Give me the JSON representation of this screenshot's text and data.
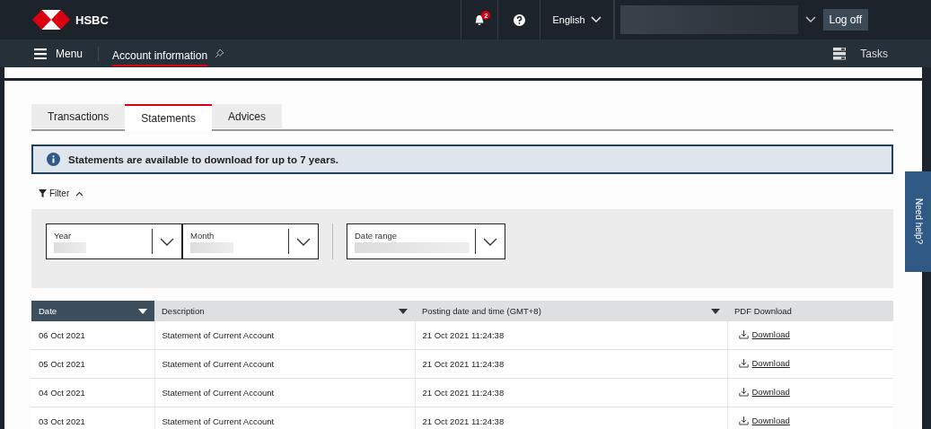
{
  "header": {
    "brand": "HSBC",
    "notifications": {
      "count": "2"
    },
    "language": "English",
    "logoff": "Log off"
  },
  "nav": {
    "menu": "Menu",
    "items": [
      {
        "label": "Account information",
        "selected": true
      }
    ],
    "tasks": "Tasks"
  },
  "tabs": [
    {
      "label": "Transactions",
      "selected": false
    },
    {
      "label": "Statements",
      "selected": true
    },
    {
      "label": "Advices",
      "selected": false
    }
  ],
  "notice": "Statements are available to download for up to 7 years.",
  "filter": {
    "label": "Filter",
    "expanded": true,
    "fields": [
      {
        "label": "Year"
      },
      {
        "label": "Month"
      },
      {
        "label": "Date range"
      }
    ]
  },
  "table": {
    "columns": [
      {
        "label": "Date",
        "sortable": true,
        "selected": true
      },
      {
        "label": "Description",
        "sortable": true,
        "selected": false
      },
      {
        "label": "Posting date and time (GMT+8)",
        "sortable": true,
        "selected": false
      },
      {
        "label": "PDF Download",
        "sortable": false,
        "selected": false
      }
    ],
    "rows": [
      [
        "06 Oct 2021",
        "Statement of Current Account",
        "21 Oct 2021 11:24:38",
        "Download"
      ],
      [
        "05 Oct 2021",
        "Statement of Current Account",
        "21 Oct 2021 11:24:38",
        "Download"
      ],
      [
        "04 Oct 2021",
        "Statement of Current Account",
        "21 Oct 2021 11:24:38",
        "Download"
      ],
      [
        "03 Oct 2021",
        "Statement of Current Account",
        "21 Oct 2021 11:24:38",
        "Download"
      ]
    ]
  },
  "help": "Need help?"
}
